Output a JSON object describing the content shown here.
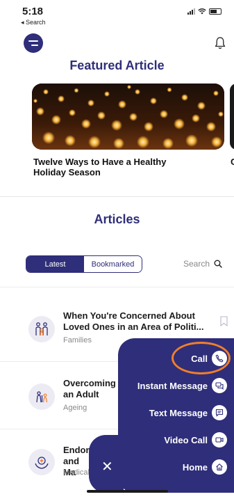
{
  "status_bar": {
    "time": "5:18",
    "back_label": "◂ Search"
  },
  "header": {
    "menu_icon": "menu-icon",
    "notification_icon": "bell-icon"
  },
  "featured": {
    "title": "Featured Article",
    "items": [
      {
        "caption": "Twelve Ways to Have a Healthy Holiday Season",
        "image": "floating-lanterns-photo"
      },
      {
        "caption": "C",
        "image": "partial-next-photo"
      }
    ]
  },
  "articles": {
    "title": "Articles",
    "tabs": [
      {
        "label": "Latest",
        "selected": true
      },
      {
        "label": "Bookmarked",
        "selected": false
      }
    ],
    "search_label": "Search",
    "items": [
      {
        "title": "When You're Concerned About Loved Ones in an Area of Politi...",
        "category": "Families",
        "icon": "family-icon"
      },
      {
        "title": "Overcoming an Adult",
        "category": "Ageing",
        "icon": "ageing-icon"
      },
      {
        "title": "Endometr and Ma",
        "category": "Medical",
        "icon": "medical-hands-icon"
      }
    ]
  },
  "contact_menu": {
    "actions": [
      {
        "label": "Call",
        "icon": "phone-icon"
      },
      {
        "label": "Instant Message",
        "icon": "chat-icon"
      },
      {
        "label": "Text Message",
        "icon": "message-icon"
      },
      {
        "label": "Video Call",
        "icon": "video-icon"
      },
      {
        "label": "Home",
        "icon": "home-icon"
      }
    ],
    "close_label": "✕",
    "highlight_color": "#f07f2a"
  },
  "colors": {
    "brand": "#2f2e7a",
    "accent": "#f07f2a"
  }
}
